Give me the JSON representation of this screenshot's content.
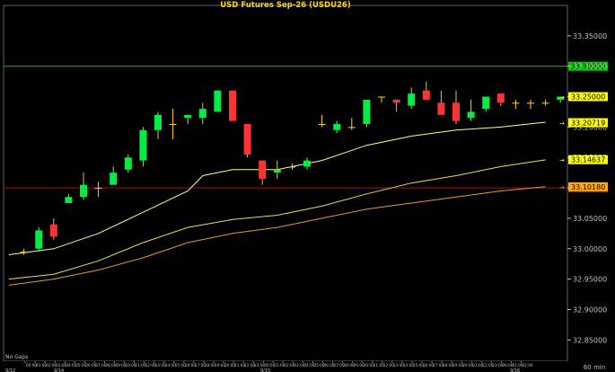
{
  "chart_data": {
    "type": "candlestick",
    "title": "USD  Futures  Sep-26  (USDU26)",
    "interval_label": "60  min",
    "note_label": "No  Gaps",
    "y_ticks": [
      "33.35000",
      "33.30000",
      "33.25000",
      "33.20000",
      "33.15000",
      "33.10000",
      "33.05000",
      "33.00000",
      "32.95000",
      "32.90000",
      "32.85000"
    ],
    "ylim": [
      32.815,
      33.4
    ],
    "x_time_labels": [
      "00:00",
      "01:00",
      "02:00",
      "03:00",
      "04:00",
      "05:00",
      "06:00",
      "07:00",
      "08:00",
      "09:00",
      "10:00",
      "11:00",
      "12:00",
      "13:00",
      "14:00",
      "15:00",
      "16:00",
      "17:00",
      "18:00",
      "19:00",
      "20:00",
      "21:00",
      "22:00",
      "23:00",
      "00:00",
      "01:00",
      "02:00",
      "03:00",
      "04:00",
      "05:00",
      "06:00",
      "07:00",
      "08:00",
      "09:00",
      "10:00",
      "11:00",
      "12:00",
      "13:00",
      "14:00",
      "15:00",
      "16:00",
      "17:00",
      "18:00",
      "19:00",
      "20:00",
      "21:00",
      "22:00",
      "23:00",
      "00:00",
      "01:00",
      "02:00"
    ],
    "x_date_labels": [
      "9/12",
      "9/14",
      "9/15",
      "9/16"
    ],
    "candles": [
      {
        "o": 32.995,
        "h": 33.0,
        "l": 32.99,
        "c": 32.995
      },
      {
        "o": 33.0,
        "h": 33.035,
        "l": 32.995,
        "c": 33.03
      },
      {
        "o": 33.04,
        "h": 33.05,
        "l": 33.015,
        "c": 33.02
      },
      {
        "o": 33.075,
        "h": 33.09,
        "l": 33.075,
        "c": 33.085
      },
      {
        "o": 33.085,
        "h": 33.125,
        "l": 33.08,
        "c": 33.105
      },
      {
        "o": 33.1,
        "h": 33.11,
        "l": 33.085,
        "c": 33.1
      },
      {
        "o": 33.105,
        "h": 33.135,
        "l": 33.105,
        "c": 33.125
      },
      {
        "o": 33.13,
        "h": 33.155,
        "l": 33.125,
        "c": 33.15
      },
      {
        "o": 33.145,
        "h": 33.2,
        "l": 33.135,
        "c": 33.195
      },
      {
        "o": 33.195,
        "h": 33.225,
        "l": 33.18,
        "c": 33.22
      },
      {
        "o": 33.205,
        "h": 33.23,
        "l": 33.18,
        "c": 33.205
      },
      {
        "o": 33.215,
        "h": 33.22,
        "l": 33.205,
        "c": 33.22
      },
      {
        "o": 33.215,
        "h": 33.24,
        "l": 33.205,
        "c": 33.23
      },
      {
        "o": 33.225,
        "h": 33.26,
        "l": 33.225,
        "c": 33.26
      },
      {
        "o": 33.26,
        "h": 33.26,
        "l": 33.21,
        "c": 33.21
      },
      {
        "o": 33.205,
        "h": 33.205,
        "l": 33.15,
        "c": 33.155
      },
      {
        "o": 33.145,
        "h": 33.145,
        "l": 33.105,
        "c": 33.115
      },
      {
        "o": 33.125,
        "h": 33.145,
        "l": 33.115,
        "c": 33.13
      },
      {
        "o": 33.135,
        "h": 33.14,
        "l": 33.13,
        "c": 33.135
      },
      {
        "o": 33.135,
        "h": 33.15,
        "l": 33.13,
        "c": 33.145
      },
      {
        "o": 33.205,
        "h": 33.22,
        "l": 33.2,
        "c": 33.205
      },
      {
        "o": 33.195,
        "h": 33.21,
        "l": 33.19,
        "c": 33.205
      },
      {
        "o": 33.2,
        "h": 33.215,
        "l": 33.195,
        "c": 33.2
      },
      {
        "o": 33.205,
        "h": 33.245,
        "l": 33.2,
        "c": 33.245
      },
      {
        "o": 33.25,
        "h": 33.25,
        "l": 33.24,
        "c": 33.25
      },
      {
        "o": 33.245,
        "h": 33.245,
        "l": 33.225,
        "c": 33.24
      },
      {
        "o": 33.235,
        "h": 33.265,
        "l": 33.23,
        "c": 33.255
      },
      {
        "o": 33.26,
        "h": 33.275,
        "l": 33.245,
        "c": 33.245
      },
      {
        "o": 33.24,
        "h": 33.26,
        "l": 33.22,
        "c": 33.22
      },
      {
        "o": 33.24,
        "h": 33.26,
        "l": 33.205,
        "c": 33.21
      },
      {
        "o": 33.215,
        "h": 33.245,
        "l": 33.21,
        "c": 33.225
      },
      {
        "o": 33.23,
        "h": 33.25,
        "l": 33.225,
        "c": 33.25
      },
      {
        "o": 33.255,
        "h": 33.255,
        "l": 33.235,
        "c": 33.24
      },
      {
        "o": 33.24,
        "h": 33.245,
        "l": 33.23,
        "c": 33.24
      },
      {
        "o": 33.24,
        "h": 33.245,
        "l": 33.23,
        "c": 33.24
      },
      {
        "o": 33.24,
        "h": 33.245,
        "l": 33.235,
        "c": 33.24
      },
      {
        "o": 33.245,
        "h": 33.25,
        "l": 33.24,
        "c": 33.25
      }
    ],
    "candle_slots": [
      1,
      2,
      3,
      4,
      5,
      6,
      7,
      8,
      9,
      10,
      11,
      12,
      13,
      14,
      15,
      16,
      17,
      18,
      19,
      20,
      21,
      22,
      23,
      24,
      25,
      26,
      27,
      28,
      29,
      30,
      31,
      32,
      33,
      34,
      35,
      36,
      37
    ],
    "moving_averages": [
      {
        "color": "#ffff80",
        "values": [
          [
            0,
            32.99
          ],
          [
            3,
            33.0
          ],
          [
            6,
            33.025
          ],
          [
            9,
            33.06
          ],
          [
            12,
            33.095
          ],
          [
            13,
            33.12
          ],
          [
            15,
            33.13
          ],
          [
            18,
            33.13
          ],
          [
            21,
            33.145
          ],
          [
            24,
            33.17
          ],
          [
            27,
            33.185
          ],
          [
            30,
            33.195
          ],
          [
            33,
            33.2
          ],
          [
            36,
            33.208
          ]
        ]
      },
      {
        "color": "#e8e04a",
        "values": [
          [
            0,
            32.95
          ],
          [
            3,
            32.958
          ],
          [
            6,
            32.98
          ],
          [
            9,
            33.01
          ],
          [
            12,
            33.035
          ],
          [
            15,
            33.048
          ],
          [
            18,
            33.055
          ],
          [
            21,
            33.07
          ],
          [
            24,
            33.09
          ],
          [
            27,
            33.108
          ],
          [
            30,
            33.12
          ],
          [
            33,
            33.135
          ],
          [
            36,
            33.146
          ]
        ]
      },
      {
        "color": "#e39a2a",
        "values": [
          [
            0,
            32.94
          ],
          [
            3,
            32.95
          ],
          [
            6,
            32.965
          ],
          [
            9,
            32.985
          ],
          [
            12,
            33.01
          ],
          [
            15,
            33.025
          ],
          [
            18,
            33.035
          ],
          [
            21,
            33.05
          ],
          [
            24,
            33.065
          ],
          [
            27,
            33.075
          ],
          [
            30,
            33.085
          ],
          [
            33,
            33.095
          ],
          [
            36,
            33.102
          ]
        ]
      }
    ],
    "h_lines": [
      {
        "value": 33.3,
        "color": "#00cc00",
        "label": "33.30000"
      },
      {
        "value": 33.1,
        "color": "#cc0000",
        "label": "33.10000"
      }
    ],
    "right_markers": [
      {
        "value": 33.25,
        "label": "33.25000",
        "color": "#ffff00"
      },
      {
        "value": 33.20719,
        "label": "33.20719",
        "color": "#ffff00"
      },
      {
        "value": 33.14637,
        "label": "33.14637",
        "color": "#ffff00"
      },
      {
        "value": 33.1018,
        "label": "33.10180",
        "color": "#ffaa00"
      }
    ],
    "colors": {
      "up": "#00ee44",
      "down": "#ff3333",
      "doji": "#ffd700",
      "axis": "#c0c0c0",
      "title": "#ffd700",
      "bg": "#000000"
    }
  }
}
